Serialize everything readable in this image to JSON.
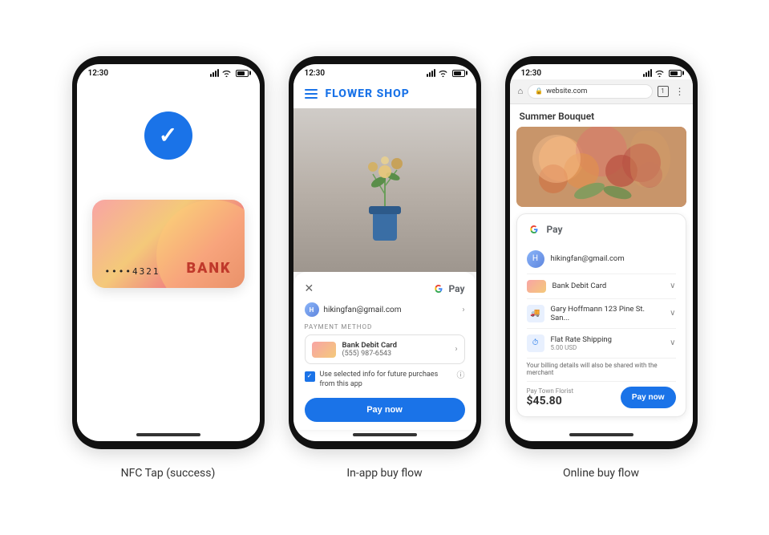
{
  "phones": [
    {
      "id": "nfc",
      "status_time": "12:30",
      "label": "NFC Tap (success)",
      "card": {
        "dots": "••••4321",
        "bank": "BANK"
      }
    },
    {
      "id": "inapp",
      "status_time": "12:30",
      "label": "In-app buy flow",
      "shop_name": "FLOWER SHOP",
      "gpay": {
        "user_email": "hikingfan@gmail.com",
        "payment_label": "PAYMENT METHOD",
        "card_name": "Bank Debit Card",
        "card_number": "(555) 987-6543",
        "checkbox_text": "Use selected info for future purchaes from this app",
        "pay_button": "Pay now"
      }
    },
    {
      "id": "online",
      "status_time": "12:30",
      "label": "Online buy flow",
      "browser_url": "website.com",
      "product_title": "Summer Bouquet",
      "gpay": {
        "user_email": "hikingfan@gmail.com",
        "card_name": "Bank Debit Card",
        "shipping_name": "Gary Hoffmann 123 Pine St. San...",
        "shipping_rate": "Flat Rate Shipping",
        "shipping_price": "5.00 USD",
        "billing_notice": "Your billing details will also be shared with the merchant",
        "pay_merchant": "Pay Town Florist",
        "total": "$45.80",
        "pay_button": "Pay now"
      }
    }
  ]
}
